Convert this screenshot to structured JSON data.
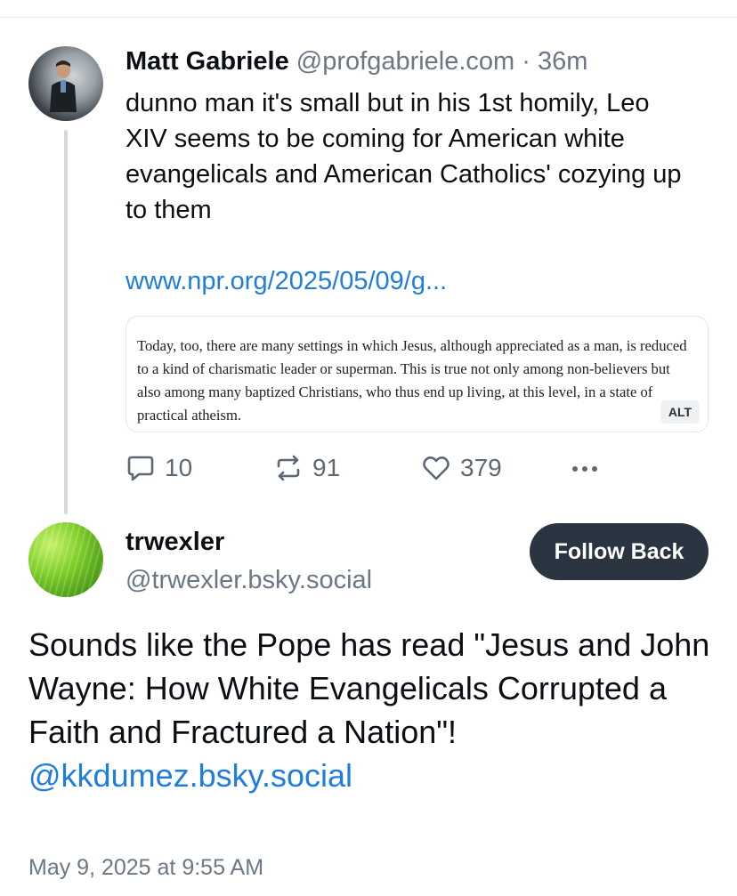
{
  "parent_post": {
    "author_name": "Matt Gabriele",
    "author_handle": "@profgabriele.com",
    "separator": "·",
    "time_ago": "36m",
    "text": "dunno man it's small but in his 1st homily, Leo XIV seems to be coming for American white evangelicals and American Catholics' cozying up to them",
    "link_text": "www.npr.org/2025/05/09/g...",
    "quote_image": {
      "text": "Today, too, there are many settings in which Jesus, although appreciated as a man, is reduced to a kind of charismatic leader or superman. This is true not only among non-believers but also among many baptized Christians, who thus end up living, at this level, in a state of practical atheism.",
      "alt_badge": "ALT"
    },
    "actions": {
      "reply_icon": "comment-icon",
      "reply_count": "10",
      "repost_icon": "repost-icon",
      "repost_count": "91",
      "like_icon": "heart-icon",
      "like_count": "379",
      "more_icon": "ellipsis-icon"
    }
  },
  "reply_post": {
    "author_name": "trwexler",
    "author_handle": "@trwexler.bsky.social",
    "follow_button": "Follow Back",
    "text": "Sounds like the Pope has read \"Jesus and John Wayne: How White Evangelicals Corrupted a Faith and Fractured a Nation\"!",
    "mention": "@kkdumez.bsky.social",
    "timestamp": "May 9, 2025 at 9:55 AM"
  },
  "colors": {
    "link": "#1e7ddf",
    "muted": "#6b7785",
    "button_bg": "#2b3441",
    "thread_line": "#d4d9de"
  }
}
